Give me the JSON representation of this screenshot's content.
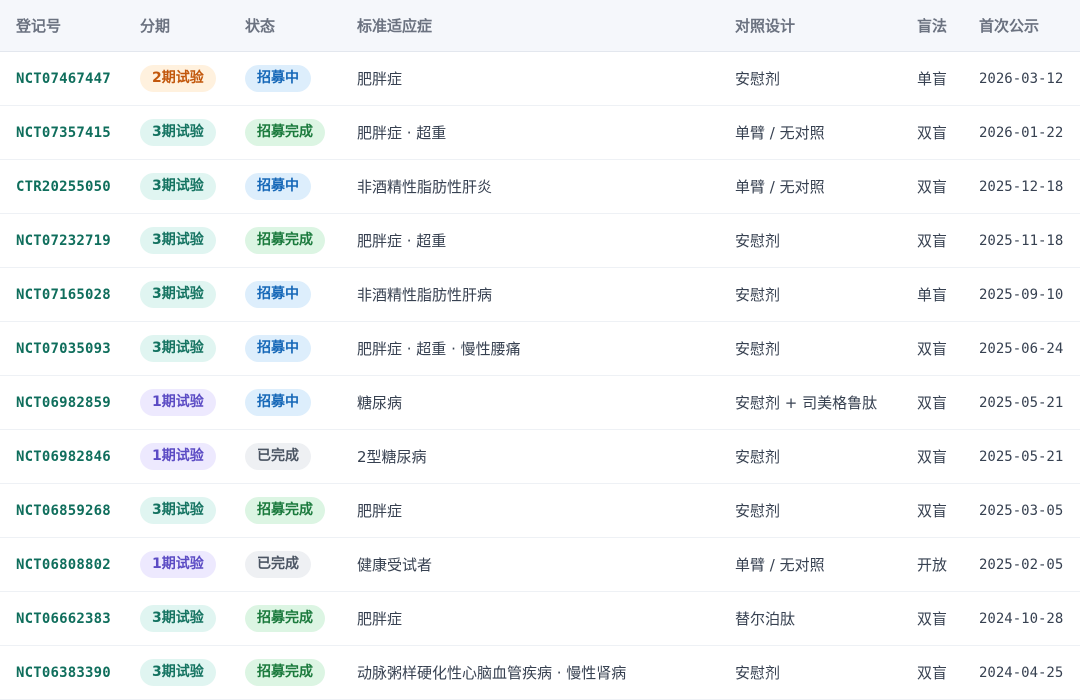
{
  "table": {
    "headers": {
      "id": "登记号",
      "phase": "分期",
      "status": "状态",
      "indication": "标准适应症",
      "control": "对照设计",
      "blinding": "盲法",
      "first_posted": "首次公示"
    },
    "rows": [
      {
        "id": "NCT07467447",
        "phase": "2期试验",
        "phase_type": "phase-2",
        "status": "招募中",
        "status_type": "st-recruiting",
        "indication": "肥胖症",
        "control": "安慰剂",
        "blinding": "单盲",
        "date": "2026-03-12"
      },
      {
        "id": "NCT07357415",
        "phase": "3期试验",
        "phase_type": "phase-3",
        "status": "招募完成",
        "status_type": "st-complete",
        "indication": "肥胖症 · 超重",
        "control": "单臂 / 无对照",
        "blinding": "双盲",
        "date": "2026-01-22"
      },
      {
        "id": "CTR20255050",
        "phase": "3期试验",
        "phase_type": "phase-3",
        "status": "招募中",
        "status_type": "st-recruiting",
        "indication": "非酒精性脂肪性肝炎",
        "control": "单臂 / 无对照",
        "blinding": "双盲",
        "date": "2025-12-18"
      },
      {
        "id": "NCT07232719",
        "phase": "3期试验",
        "phase_type": "phase-3",
        "status": "招募完成",
        "status_type": "st-complete",
        "indication": "肥胖症 · 超重",
        "control": "安慰剂",
        "blinding": "双盲",
        "date": "2025-11-18"
      },
      {
        "id": "NCT07165028",
        "phase": "3期试验",
        "phase_type": "phase-3",
        "status": "招募中",
        "status_type": "st-recruiting",
        "indication": "非酒精性脂肪性肝病",
        "control": "安慰剂",
        "blinding": "单盲",
        "date": "2025-09-10"
      },
      {
        "id": "NCT07035093",
        "phase": "3期试验",
        "phase_type": "phase-3",
        "status": "招募中",
        "status_type": "st-recruiting",
        "indication": "肥胖症 · 超重 · 慢性腰痛",
        "control": "安慰剂",
        "blinding": "双盲",
        "date": "2025-06-24"
      },
      {
        "id": "NCT06982859",
        "phase": "1期试验",
        "phase_type": "phase-1",
        "status": "招募中",
        "status_type": "st-recruiting",
        "indication": "糖尿病",
        "control": "安慰剂 + 司美格鲁肽",
        "blinding": "双盲",
        "date": "2025-05-21"
      },
      {
        "id": "NCT06982846",
        "phase": "1期试验",
        "phase_type": "phase-1",
        "status": "已完成",
        "status_type": "st-done",
        "indication": "2型糖尿病",
        "control": "安慰剂",
        "blinding": "双盲",
        "date": "2025-05-21"
      },
      {
        "id": "NCT06859268",
        "phase": "3期试验",
        "phase_type": "phase-3",
        "status": "招募完成",
        "status_type": "st-complete",
        "indication": "肥胖症",
        "control": "安慰剂",
        "blinding": "双盲",
        "date": "2025-03-05"
      },
      {
        "id": "NCT06808802",
        "phase": "1期试验",
        "phase_type": "phase-1",
        "status": "已完成",
        "status_type": "st-done",
        "indication": "健康受试者",
        "control": "单臂 / 无对照",
        "blinding": "开放",
        "date": "2025-02-05"
      },
      {
        "id": "NCT06662383",
        "phase": "3期试验",
        "phase_type": "phase-3",
        "status": "招募完成",
        "status_type": "st-complete",
        "indication": "肥胖症",
        "control": "替尔泊肽",
        "blinding": "双盲",
        "date": "2024-10-28"
      },
      {
        "id": "NCT06383390",
        "phase": "3期试验",
        "phase_type": "phase-3",
        "status": "招募完成",
        "status_type": "st-complete",
        "indication": "动脉粥样硬化性心脑血管疾病 · 慢性肾病",
        "control": "安慰剂",
        "blinding": "双盲",
        "date": "2024-04-25"
      }
    ]
  }
}
